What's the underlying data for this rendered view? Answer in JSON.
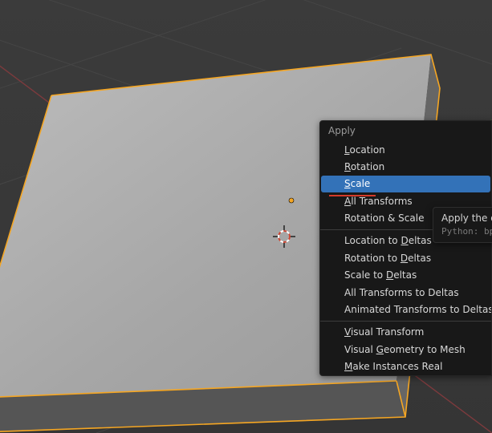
{
  "menu": {
    "title": "Apply",
    "groups": [
      [
        {
          "label": "Location",
          "u": 0,
          "name": "menu-item-location"
        },
        {
          "label": "Rotation",
          "u": 0,
          "name": "menu-item-rotation"
        },
        {
          "label": "Scale",
          "u": 0,
          "name": "menu-item-scale",
          "highlight": true
        },
        {
          "label": "All Transforms",
          "u": 0,
          "name": "menu-item-all-transforms"
        },
        {
          "label": "Rotation & Scale",
          "u": -1,
          "name": "menu-item-rotation-scale"
        }
      ],
      [
        {
          "label": "Location to Deltas",
          "u": 12,
          "name": "menu-item-location-to-deltas"
        },
        {
          "label": "Rotation to Deltas",
          "u": 12,
          "name": "menu-item-rotation-to-deltas"
        },
        {
          "label": "Scale to Deltas",
          "u": 9,
          "name": "menu-item-scale-to-deltas"
        },
        {
          "label": "All Transforms to Deltas",
          "u": -1,
          "name": "menu-item-all-transforms-to-deltas"
        },
        {
          "label": "Animated Transforms to Deltas",
          "u": -1,
          "name": "menu-item-animated-transforms-to-deltas"
        }
      ],
      [
        {
          "label": "Visual Transform",
          "u": 0,
          "name": "menu-item-visual-transform"
        },
        {
          "label": "Visual Geometry to Mesh",
          "u": 7,
          "name": "menu-item-visual-geometry-to-mesh"
        },
        {
          "label": "Make Instances Real",
          "u": 0,
          "name": "menu-item-make-instances-real"
        }
      ]
    ]
  },
  "tooltip": {
    "line1": "Apply the obj",
    "line2": "Python: bpy"
  }
}
